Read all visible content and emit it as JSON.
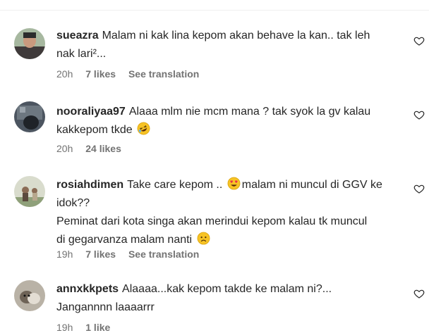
{
  "comments": [
    {
      "username": "sueazra",
      "lines": [
        "Malam ni kak lina kepom akan behave la kan.. tak leh",
        "nak lari²..."
      ],
      "time": "20h",
      "likes": "7 likes",
      "translation": "See translation"
    },
    {
      "username": "nooraliyaa97",
      "lines": [
        "Alaaa mlm nie mcm mana ? tak syok la gv kalau",
        "kakkepom tkde"
      ],
      "time": "20h",
      "likes": "24 likes",
      "translation": ""
    },
    {
      "username": "rosiahdimen",
      "lines": [
        "Take care kepom ..",
        "malam ni muncul di GGV ke",
        "idok??",
        "Peminat dari kota singa akan merindui kepom kalau tk muncul",
        "di gegarvanza malam nanti"
      ],
      "time": "19h",
      "likes": "7 likes",
      "translation": "See translation"
    },
    {
      "username": "annxkkpets",
      "lines": [
        "Alaaaa...kak kepom takde ke malam ni?...",
        "Jangannnn laaaarrr"
      ],
      "time": "19h",
      "likes": "1 like",
      "translation": ""
    }
  ],
  "icons": {
    "like": "heart-outline-icon",
    "laugh": "rolling-laughing-emoji",
    "love": "heart-eyes-emoji",
    "sad": "sad-face-emoji"
  },
  "colors": {
    "text": "#262626",
    "meta": "#737373",
    "emoji": "#f7c325"
  }
}
